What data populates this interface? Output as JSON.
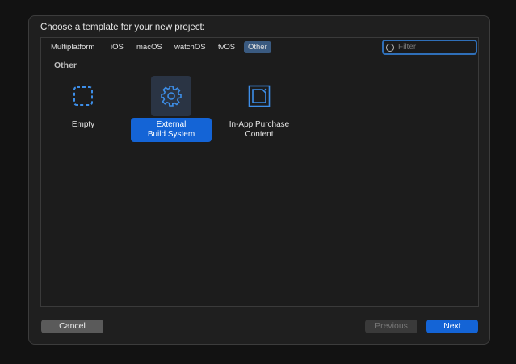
{
  "dialog": {
    "title": "Choose a template for your new project:"
  },
  "tabs": [
    {
      "label": "Multiplatform"
    },
    {
      "label": "iOS"
    },
    {
      "label": "macOS"
    },
    {
      "label": "watchOS"
    },
    {
      "label": "tvOS"
    },
    {
      "label": "Other",
      "selected": true
    }
  ],
  "filter": {
    "placeholder": "Filter",
    "icon": "filter-icon"
  },
  "section": {
    "title": "Other"
  },
  "templates": [
    {
      "label": "Empty",
      "icon": "dashed-square-icon"
    },
    {
      "label_line1": "External",
      "label_line2": "Build System",
      "icon": "gear-icon",
      "selected": true
    },
    {
      "label_line1": "In-App Purchase",
      "label_line2": "Content",
      "icon": "in-app-purchase-icon"
    }
  ],
  "buttons": {
    "cancel": "Cancel",
    "previous": "Previous",
    "next": "Next"
  },
  "colors": {
    "accent": "#1464d6",
    "icon": "#3d8ee8"
  }
}
